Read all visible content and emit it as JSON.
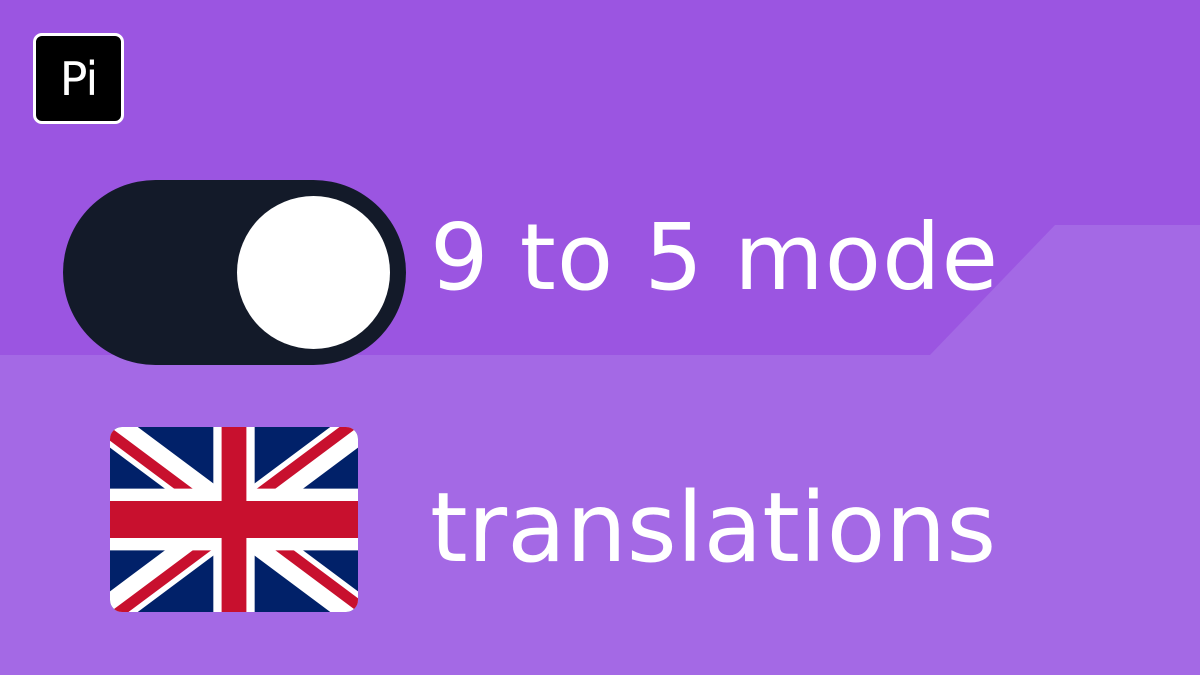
{
  "logo": {
    "text": "Pi"
  },
  "toggle": {
    "state": "on",
    "label": "9 to 5 mode"
  },
  "language": {
    "flag_icon": "uk-flag-icon",
    "label": "translations"
  },
  "colors": {
    "background": "#9b55e1",
    "lower_band": "#a469e5",
    "toggle_track": "#131a29",
    "toggle_knob": "#ffffff",
    "text": "#ffffff",
    "logo_bg": "#000000"
  }
}
